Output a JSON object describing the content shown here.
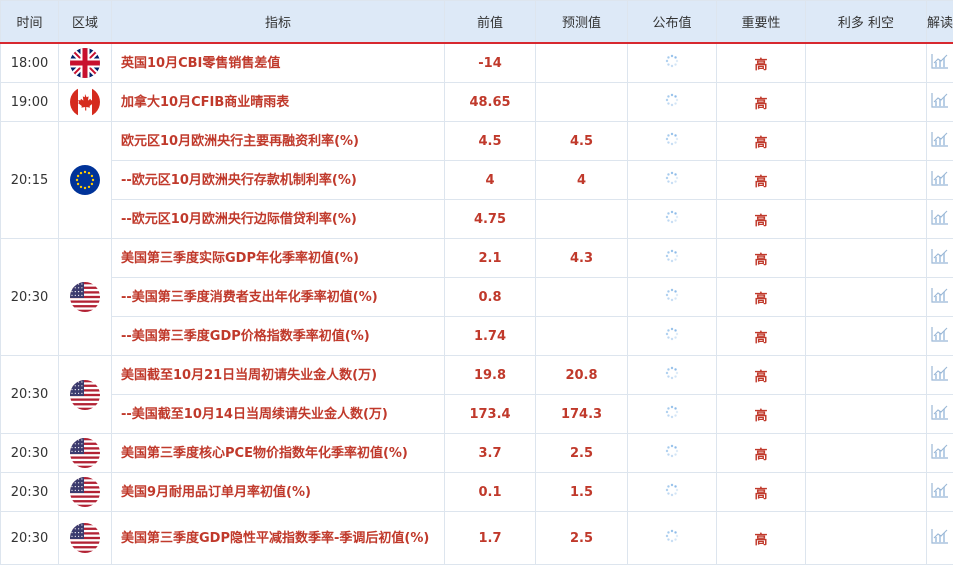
{
  "header": {
    "time": "时间",
    "region": "区域",
    "indicator": "指标",
    "previous": "前值",
    "forecast": "预测值",
    "actual": "公布值",
    "importance": "重要性",
    "impact": "利多 利空",
    "interpret": "解读"
  },
  "rows": [
    {
      "time": "18:00",
      "flag": "uk",
      "indicator": "英国10月CBI零售销售差值",
      "previous": "-14",
      "forecast": "",
      "importance": "高"
    },
    {
      "time": "19:00",
      "flag": "ca",
      "indicator": "加拿大10月CFIB商业晴雨表",
      "previous": "48.65",
      "forecast": "",
      "importance": "高"
    },
    {
      "time": "20:15",
      "flag": "eu",
      "indicator": "欧元区10月欧洲央行主要再融资利率(%)",
      "previous": "4.5",
      "forecast": "4.5",
      "importance": "高"
    },
    {
      "indicator": "--欧元区10月欧洲央行存款机制利率(%)",
      "previous": "4",
      "forecast": "4",
      "importance": "高"
    },
    {
      "indicator": "--欧元区10月欧洲央行边际借贷利率(%)",
      "previous": "4.75",
      "forecast": "",
      "importance": "高"
    },
    {
      "time": "20:30",
      "flag": "us",
      "indicator": "美国第三季度实际GDP年化季率初值(%)",
      "previous": "2.1",
      "forecast": "4.3",
      "importance": "高"
    },
    {
      "indicator": "--美国第三季度消费者支出年化季率初值(%)",
      "previous": "0.8",
      "forecast": "",
      "importance": "高"
    },
    {
      "indicator": "--美国第三季度GDP价格指数季率初值(%)",
      "previous": "1.74",
      "forecast": "",
      "importance": "高"
    },
    {
      "time": "20:30",
      "flag": "us",
      "indicator": "美国截至10月21日当周初请失业金人数(万)",
      "previous": "19.8",
      "forecast": "20.8",
      "importance": "高"
    },
    {
      "indicator": "--美国截至10月14日当周续请失业金人数(万)",
      "previous": "173.4",
      "forecast": "174.3",
      "importance": "高"
    },
    {
      "time": "20:30",
      "flag": "us",
      "indicator": "美国第三季度核心PCE物价指数年化季率初值(%)",
      "previous": "3.7",
      "forecast": "2.5",
      "importance": "高"
    },
    {
      "time": "20:30",
      "flag": "us",
      "indicator": "美国9月耐用品订单月率初值(%)",
      "previous": "0.1",
      "forecast": "1.5",
      "importance": "高"
    },
    {
      "time": "20:30",
      "flag": "us",
      "indicator": "美国第三季度GDP隐性平减指数季率-季调后初值(%)",
      "previous": "1.7",
      "forecast": "2.5",
      "importance": "高"
    }
  ],
  "colors": {
    "accent_red": "#c0392b",
    "header_bg": "#dde9f7",
    "header_border": "#d7282f"
  }
}
